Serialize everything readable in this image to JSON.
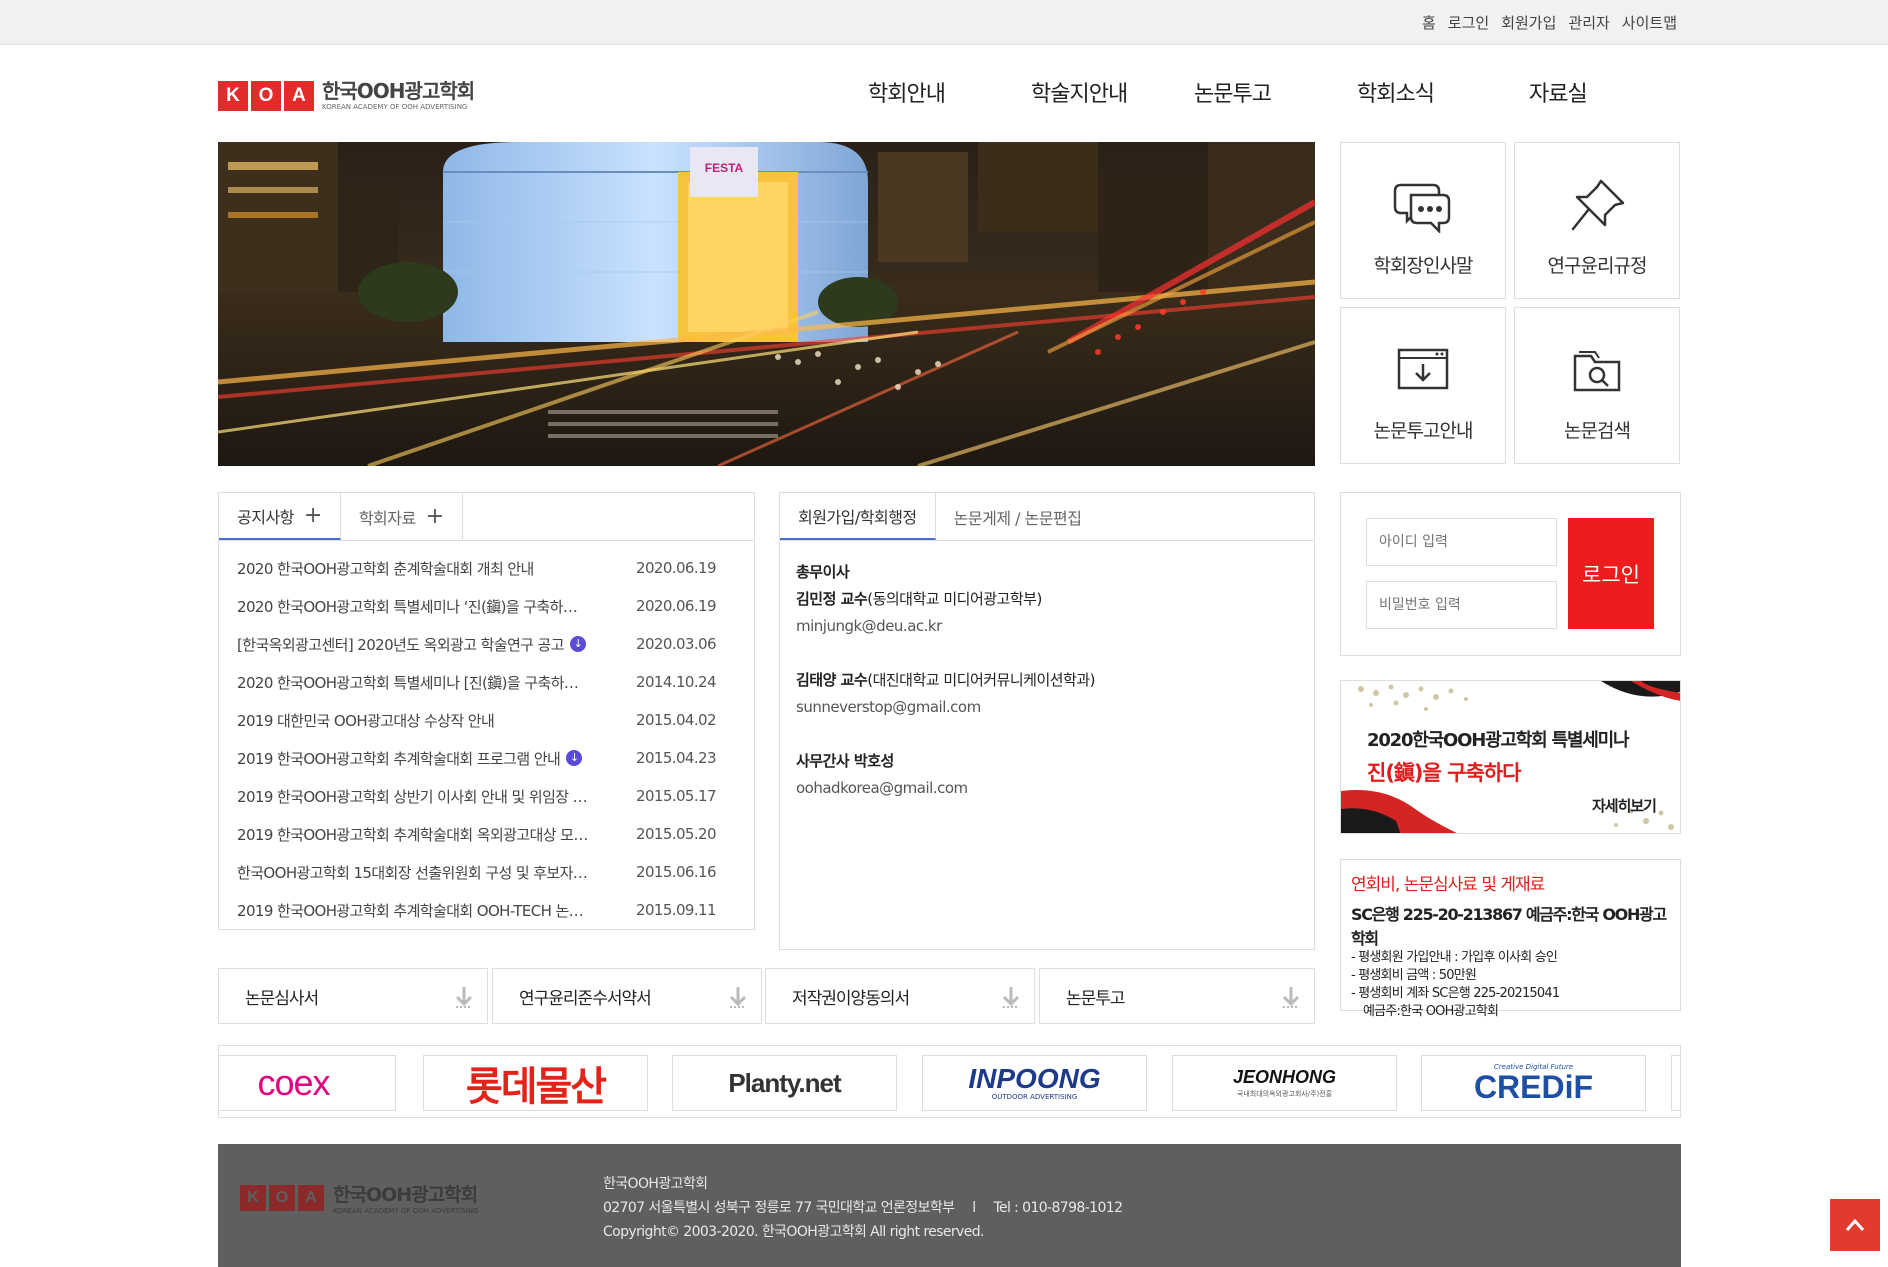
{
  "util_nav": [
    "홈",
    "로그인",
    "회원가입",
    "관리자",
    "사이트맵"
  ],
  "logo": {
    "letters": [
      "K",
      "O",
      "A"
    ],
    "name_kr": "한국OOH광고학회",
    "name_en": "KOREAN ACADEMY OF OOH ADVERTISING"
  },
  "gnb": [
    "학회안내",
    "학술지안내",
    "논문투고",
    "학회소식",
    "자료실"
  ],
  "hero": {
    "billboard_text": "FESTA"
  },
  "tiles": [
    {
      "label": "학회장인사말",
      "icon": "chat-bubble-icon"
    },
    {
      "label": "연구윤리규정",
      "icon": "pushpin-icon"
    },
    {
      "label": "논문투고안내",
      "icon": "download-window-icon"
    },
    {
      "label": "논문검색",
      "icon": "folder-search-icon"
    }
  ],
  "notice": {
    "tabs": [
      {
        "label": "공지사항",
        "plus": "+"
      },
      {
        "label": "학회자료",
        "plus": "+"
      }
    ],
    "items": [
      {
        "title": "2020 한국OOH광고학회 춘계학술대회 개최 안내",
        "date": "2020.06.19",
        "attach": false
      },
      {
        "title": "2020 한국OOH광고학회 특별세미나 ‘진(鎭)을 구축하…",
        "date": "2020.06.19",
        "attach": false
      },
      {
        "title": "[한국옥외광고센터] 2020년도 옥외광고 학술연구 공고",
        "date": "2020.03.06",
        "attach": true
      },
      {
        "title": "2020 한국OOH광고학회 특별세미나 [진(鎭)을 구축하…",
        "date": "2014.10.24",
        "attach": false
      },
      {
        "title": "2019 대한민국 OOH광고대상 수상작 안내",
        "date": "2015.04.02",
        "attach": false
      },
      {
        "title": "2019 한국OOH광고학회 추계학술대회 프로그램 안내",
        "date": "2015.04.23",
        "attach": true
      },
      {
        "title": "2019 한국OOH광고학회 상반기 이사회 안내 및 위임장 …",
        "date": "2015.05.17",
        "attach": false
      },
      {
        "title": "2019 한국OOH광고학회 추계학술대회 옥외광고대상 모…",
        "date": "2015.05.20",
        "attach": false
      },
      {
        "title": "한국OOH광고학회 15대회장 선출위원회 구성 및 후보자…",
        "date": "2015.06.16",
        "attach": false
      },
      {
        "title": "2019 한국OOH광고학회 추계학술대회 OOH-TECH 논…",
        "date": "2015.09.11",
        "attach": false
      }
    ],
    "attach_glyph": "↓"
  },
  "contact": {
    "tabs": [
      "회원가입/학회행정",
      "논문게제 / 논문편집"
    ],
    "groups": [
      {
        "role": "총무이사",
        "name": "김민정 교수",
        "affil": "(동의대학교 미디어광고학부)",
        "email": "minjungk@deu.ac.kr"
      },
      {
        "role": "",
        "name": "김태양 교수",
        "affil": "(대진대학교 미디어커뮤니케이션학과)",
        "email": "sunneverstop@gmail.com"
      },
      {
        "role": "",
        "name": "사무간사 박호성",
        "affil": "",
        "email": "oohadkorea@gmail.com"
      }
    ]
  },
  "login": {
    "id_placeholder": "아이디 입력",
    "pw_placeholder": "비밀번호 입력",
    "button": "로그인"
  },
  "banner": {
    "line1": "2020한국OOH광고학회 특별세미나",
    "line2": "진(鎭)을 구축하다",
    "more": "자세히보기"
  },
  "fee": {
    "title": "연회비, 논문심사료 및 게재료",
    "account": "SC은행 225-20-213867 예금주:한국 OOH광고학회",
    "lines": [
      "- 평생회원 가입안내 : 가입후 이사회 승인",
      "- 평생회비 금액 : 50만원",
      "- 평생회비 계좌 SC은행 225-20215041",
      "   예금주:한국 OOH광고학회"
    ]
  },
  "downloads": [
    "논문심사서",
    "연구윤리준수서약서",
    "저작권이양동의서",
    "논문투고"
  ],
  "partners": [
    {
      "name": "coex",
      "color": "#e6007e"
    },
    {
      "name": "롯데물산",
      "color": "#e2231a"
    },
    {
      "name": "Planty.net",
      "color": "#333333"
    },
    {
      "name": "INPOONG",
      "color": "#1e3a8a",
      "sub": "OUTDOOR ADVERTISING"
    },
    {
      "name": "JEONHONG",
      "color": "#111111",
      "sub": "국내최대의옥외광고회사/주)전홍"
    },
    {
      "name": "CREDiF",
      "color": "#1d4fa5",
      "sub": "Creative Digital Future"
    }
  ],
  "footer": {
    "org": "한국OOH광고학회",
    "address": "02707 서울특별시 성북구 정릉로 77 국민대학교 언론정보학부",
    "sep": "l",
    "tel": "Tel : 010-8798-1012",
    "copyright": "Copyright© 2003-2020. 한국OOH광고학회 All right reserved."
  },
  "colors": {
    "brand_red": "#e32b2b",
    "login_red": "#ee1c1c",
    "tab_blue": "#4a6fd0",
    "footer_bg": "#5f5f5f"
  }
}
